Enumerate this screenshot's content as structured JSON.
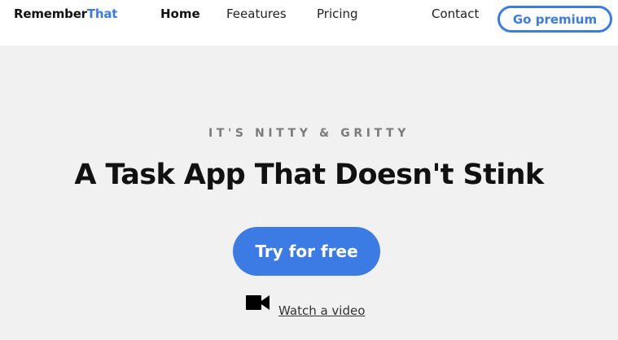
{
  "nav": {
    "logo_main": "Remember",
    "logo_accent": "That",
    "links": [
      {
        "label": "Home",
        "active": true
      },
      {
        "label": "Feeatures",
        "active": false
      },
      {
        "label": "Pricing",
        "active": false
      },
      {
        "label": "Contact",
        "active": false
      }
    ],
    "premium_label": "Go premium"
  },
  "hero": {
    "eyebrow": "IT'S NITTY & GRITTY",
    "headline": "A Task App That Doesn't Stink",
    "cta_label": "Try for free",
    "video_icon": "video-camera-icon",
    "video_link_label": "Watch a video"
  },
  "colors": {
    "accent": "#3b7be3",
    "hero_bg": "#f1f1f1",
    "eyebrow": "#7b7b7b"
  }
}
